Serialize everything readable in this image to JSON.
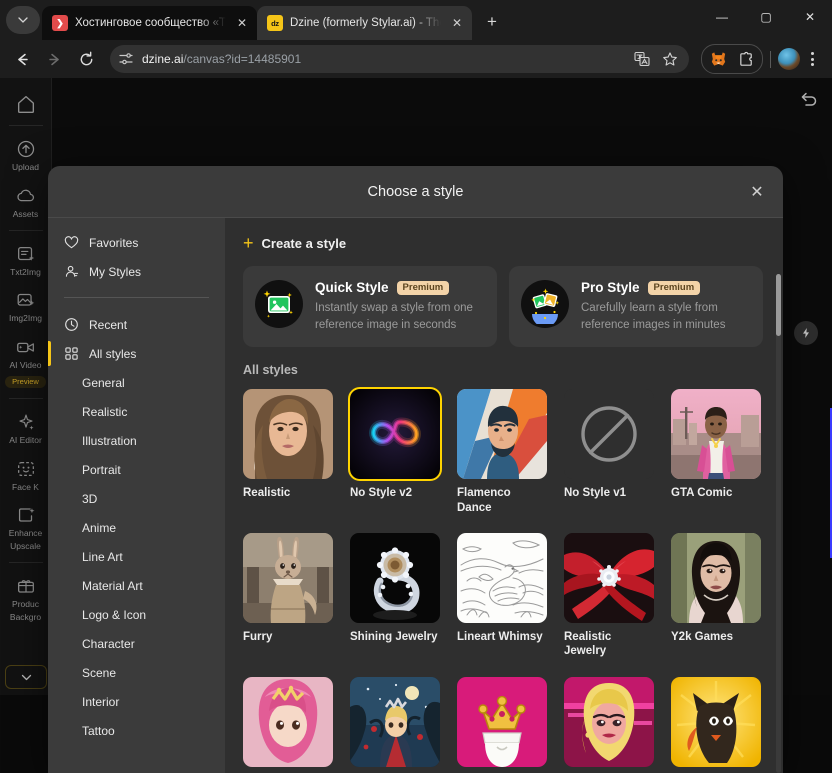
{
  "browser": {
    "tabs": [
      {
        "title": "Хостинговое сообщество «Tim",
        "favicon": "red-arrow-icon",
        "active": false
      },
      {
        "title": "Dzine (formerly Stylar.ai) - The N",
        "favicon": "dzine-icon",
        "active": true
      }
    ],
    "new_tab_label": "+",
    "tab_menu_label": "⌄",
    "window_controls": {
      "minimize": "—",
      "maximize": "▢",
      "close": "✕"
    },
    "toolbar": {
      "back_label": "←",
      "forward_label": "→",
      "reload_label": "⟳",
      "url_host": "dzine.ai",
      "url_path": "/canvas?id=14485901",
      "site_info_icon": "tune-icon",
      "translate_icon": "translate-icon",
      "bookmark_icon": "star-icon",
      "metamask_icon": "fox-icon",
      "extensions_icon": "puzzle-icon",
      "profile_icon": "avatar-icon",
      "menu_icon": "kebab-menu-icon"
    }
  },
  "app_sidebar": {
    "home_icon": "home-icon",
    "items": [
      {
        "label": "Upload",
        "icon": "upload-icon"
      },
      {
        "label": "Assets",
        "icon": "cloud-icon"
      },
      {
        "label": "Txt2Img",
        "icon": "text-to-image-icon"
      },
      {
        "label": "Img2Img",
        "icon": "image-to-image-icon"
      },
      {
        "label": "AI Video",
        "icon": "video-icon",
        "badge": "Preview"
      },
      {
        "label": "AI Editor",
        "icon": "sparkle-icon"
      },
      {
        "label": "Face K",
        "icon": "face-icon"
      },
      {
        "label": "Enhance",
        "label2": "Upscale",
        "icon": "enhance-icon"
      },
      {
        "label": "Produc",
        "label2": "Backgro",
        "icon": "product-icon"
      }
    ],
    "expand_label": "⌄"
  },
  "canvas": {
    "undo_icon": "undo-icon",
    "quick_action_icon": "flash-icon"
  },
  "modal": {
    "title": "Choose a style",
    "close_label": "✕",
    "nav": {
      "top": [
        {
          "label": "Favorites",
          "icon": "heart-icon"
        },
        {
          "label": "My Styles",
          "icon": "person-icon"
        }
      ],
      "main": [
        {
          "label": "Recent",
          "icon": "clock-icon",
          "active": false
        },
        {
          "label": "All styles",
          "icon": "grid-icon",
          "active": true
        },
        {
          "label": "General",
          "active": false
        },
        {
          "label": "Realistic",
          "active": false
        },
        {
          "label": "Illustration",
          "active": false
        },
        {
          "label": "Portrait",
          "active": false
        },
        {
          "label": "3D",
          "active": false
        },
        {
          "label": "Anime",
          "active": false
        },
        {
          "label": "Line Art",
          "active": false
        },
        {
          "label": "Material Art",
          "active": false
        },
        {
          "label": "Logo & Icon",
          "active": false
        },
        {
          "label": "Character",
          "active": false
        },
        {
          "label": "Scene",
          "active": false
        },
        {
          "label": "Interior",
          "active": false
        },
        {
          "label": "Tattoo",
          "active": false
        }
      ]
    },
    "create_style": {
      "label": "Create a style",
      "plus": "+"
    },
    "cards": [
      {
        "title": "Quick Style",
        "badge": "Premium",
        "description": "Instantly swap a style from one reference image in seconds",
        "icon": "quick-style-icon"
      },
      {
        "title": "Pro Style",
        "badge": "Premium",
        "description": "Carefully learn a style from reference images in minutes",
        "icon": "pro-style-icon"
      }
    ],
    "section_label": "All styles",
    "styles": [
      {
        "label": "Realistic",
        "selected": false,
        "thumb": "woman-portrait"
      },
      {
        "label": "No Style v2",
        "selected": true,
        "thumb": "neon-infinity"
      },
      {
        "label": "Flamenco Dance",
        "selected": false,
        "thumb": "vector-man"
      },
      {
        "label": "No Style v1",
        "selected": false,
        "thumb": "no-style-circle"
      },
      {
        "label": "GTA Comic",
        "selected": false,
        "thumb": "gta-man"
      },
      {
        "label": "Furry",
        "selected": false,
        "thumb": "bunny-girl"
      },
      {
        "label": "Shining Jewelry",
        "selected": false,
        "thumb": "diamond-ring"
      },
      {
        "label": "Lineart Whimsy",
        "selected": false,
        "thumb": "swan-lineart"
      },
      {
        "label": "Realistic Jewelry",
        "selected": false,
        "thumb": "red-ribbon"
      },
      {
        "label": "Y2k Games",
        "selected": false,
        "thumb": "dark-hair-woman"
      },
      {
        "label": "",
        "selected": false,
        "thumb": "pink-princess"
      },
      {
        "label": "",
        "selected": false,
        "thumb": "night-prince"
      },
      {
        "label": "",
        "selected": false,
        "thumb": "crown-magenta"
      },
      {
        "label": "",
        "selected": false,
        "thumb": "blonde-pixel"
      },
      {
        "label": "",
        "selected": false,
        "thumb": "yellow-cat"
      }
    ]
  },
  "colors": {
    "accent": "#f5c518",
    "selection": "#ffd400",
    "modal_bg": "#3b3b3b",
    "modal_main_bg": "#2f2f2f",
    "premium_pill": "#f3d3a8"
  }
}
